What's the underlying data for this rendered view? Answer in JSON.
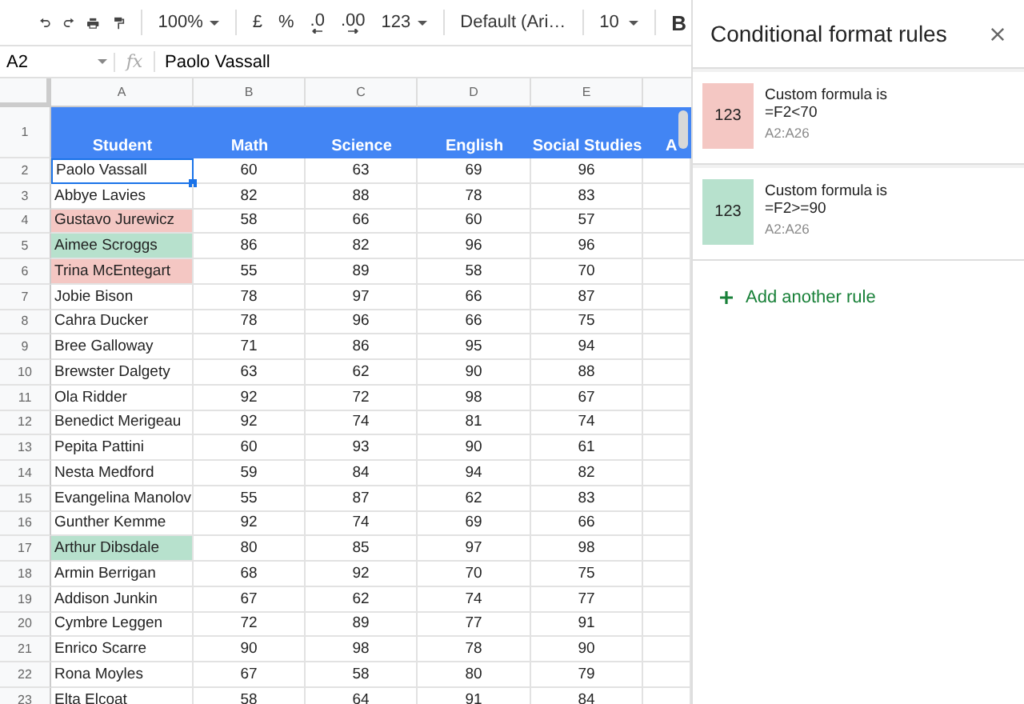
{
  "toolbar": {
    "zoom": "100%",
    "currency": "£",
    "percent": "%",
    "decrease_decimals": ".0",
    "increase_decimals": ".00",
    "number_format": "123",
    "font": "Default (Ari…",
    "font_size": "10",
    "bold": "B"
  },
  "formula_bar": {
    "cell_ref": "A2",
    "fx": "fx",
    "value": "Paolo Vassall"
  },
  "sheet": {
    "column_letters": [
      "A",
      "B",
      "C",
      "D",
      "E"
    ],
    "header_row": {
      "number": "1",
      "cells": [
        "Student",
        "Math",
        "Science",
        "English",
        "Social Studies",
        "A"
      ]
    },
    "rows": [
      {
        "number": "2",
        "cells": [
          "Paolo Vassall",
          "60",
          "63",
          "69",
          "96"
        ],
        "selected": true
      },
      {
        "number": "3",
        "cells": [
          "Abbye Lavies",
          "82",
          "88",
          "78",
          "83"
        ],
        "selected": false
      },
      {
        "number": "4",
        "cells": [
          "Gustavo Jurewicz",
          "58",
          "66",
          "60",
          "57"
        ],
        "selected": false,
        "color": "#f4c7c3"
      },
      {
        "number": "5",
        "cells": [
          "Aimee Scroggs",
          "86",
          "82",
          "96",
          "96"
        ],
        "selected": false,
        "color": "#b7e1cd"
      },
      {
        "number": "6",
        "cells": [
          "Trina McEntegart",
          "55",
          "89",
          "58",
          "70"
        ],
        "selected": false,
        "color": "#f4c7c3"
      },
      {
        "number": "7",
        "cells": [
          "Jobie Bison",
          "78",
          "97",
          "66",
          "87"
        ],
        "selected": false
      },
      {
        "number": "8",
        "cells": [
          "Cahra Ducker",
          "78",
          "96",
          "66",
          "75"
        ],
        "selected": false
      },
      {
        "number": "9",
        "cells": [
          "Bree Galloway",
          "71",
          "86",
          "95",
          "94"
        ],
        "selected": false
      },
      {
        "number": "10",
        "cells": [
          "Brewster Dalgety",
          "63",
          "62",
          "90",
          "88"
        ],
        "selected": false
      },
      {
        "number": "11",
        "cells": [
          "Ola Ridder",
          "92",
          "72",
          "98",
          "67"
        ],
        "selected": false
      },
      {
        "number": "12",
        "cells": [
          "Benedict Merigeau",
          "92",
          "74",
          "81",
          "74"
        ],
        "selected": false
      },
      {
        "number": "13",
        "cells": [
          "Pepita Pattini",
          "60",
          "93",
          "90",
          "61"
        ],
        "selected": false
      },
      {
        "number": "14",
        "cells": [
          "Nesta Medford",
          "59",
          "84",
          "94",
          "82"
        ],
        "selected": false
      },
      {
        "number": "15",
        "cells": [
          "Evangelina Manolov",
          "55",
          "87",
          "62",
          "83"
        ],
        "selected": false
      },
      {
        "number": "16",
        "cells": [
          "Gunther Kemme",
          "92",
          "74",
          "69",
          "66"
        ],
        "selected": false
      },
      {
        "number": "17",
        "cells": [
          "Arthur Dibsdale",
          "80",
          "85",
          "97",
          "98"
        ],
        "selected": false,
        "color": "#b7e1cd"
      },
      {
        "number": "18",
        "cells": [
          "Armin Berrigan",
          "68",
          "92",
          "70",
          "75"
        ],
        "selected": false
      },
      {
        "number": "19",
        "cells": [
          "Addison Junkin",
          "67",
          "62",
          "74",
          "77"
        ],
        "selected": false
      },
      {
        "number": "20",
        "cells": [
          "Cymbre Leggen",
          "72",
          "89",
          "77",
          "91"
        ],
        "selected": false
      },
      {
        "number": "21",
        "cells": [
          "Enrico Scarre",
          "90",
          "98",
          "78",
          "90"
        ],
        "selected": false
      },
      {
        "number": "22",
        "cells": [
          "Rona Moyles",
          "67",
          "58",
          "80",
          "79"
        ],
        "selected": false
      },
      {
        "number": "23",
        "cells": [
          "Elta Elcoat",
          "58",
          "64",
          "91",
          "84"
        ],
        "selected": false
      }
    ]
  },
  "panel": {
    "title": "Conditional format rules",
    "rules": [
      {
        "preview": "123",
        "color": "#f4c7c3",
        "condition": "Custom formula is",
        "formula": "=F2<70",
        "range": "A2:A26"
      },
      {
        "preview": "123",
        "color": "#b7e1cd",
        "condition": "Custom formula is",
        "formula": "=F2>=90",
        "range": "A2:A26"
      }
    ],
    "add_rule": "Add another rule"
  }
}
